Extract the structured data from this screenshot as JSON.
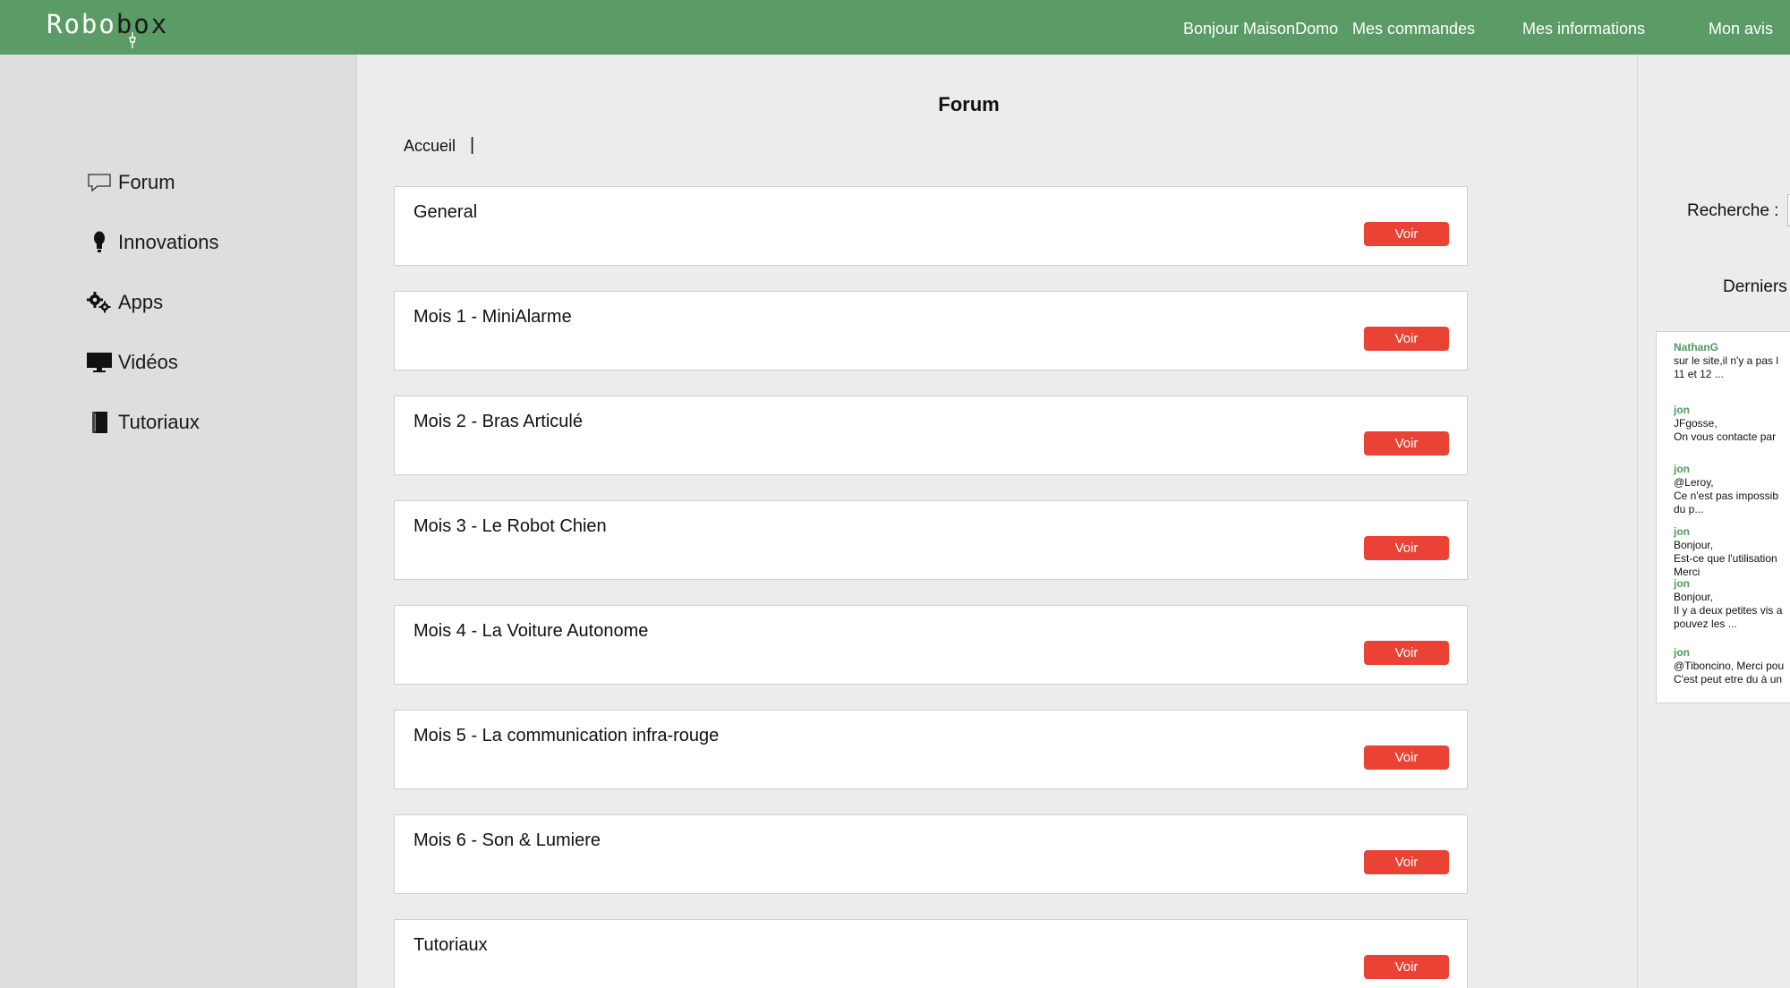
{
  "header": {
    "logo_part1": "Robo",
    "logo_part2": "box",
    "nav": [
      {
        "label": "Bonjour MaisonDomo"
      },
      {
        "label": "Mes commandes"
      },
      {
        "label": "Mes informations"
      },
      {
        "label": "Mon avis"
      }
    ],
    "colors": {
      "bar": "#5b9b65",
      "text": "#ffffff"
    }
  },
  "sidebar": {
    "items": [
      {
        "label": "Forum",
        "icon": "speech-bubble-icon"
      },
      {
        "label": "Innovations",
        "icon": "lightbulb-icon"
      },
      {
        "label": "Apps",
        "icon": "gears-icon"
      },
      {
        "label": "Vidéos",
        "icon": "monitor-icon"
      },
      {
        "label": "Tutoriaux",
        "icon": "book-icon"
      }
    ]
  },
  "main": {
    "title": "Forum",
    "breadcrumb": {
      "home": "Accueil",
      "separator": "|"
    },
    "button_color": "#ea4335",
    "categories": [
      {
        "title": "General",
        "button": "Voir"
      },
      {
        "title": "Mois 1 - MiniAlarme",
        "button": "Voir"
      },
      {
        "title": "Mois 2 - Bras Articulé",
        "button": "Voir"
      },
      {
        "title": "Mois 3 - Le Robot Chien",
        "button": "Voir"
      },
      {
        "title": "Mois 4 - La Voiture Autonome",
        "button": "Voir"
      },
      {
        "title": "Mois 5 - La communication infra-rouge",
        "button": "Voir"
      },
      {
        "title": "Mois 6 - Son & Lumiere",
        "button": "Voir"
      },
      {
        "title": "Tutoriaux",
        "button": "Voir"
      }
    ]
  },
  "right": {
    "search_label": "Recherche :",
    "latest_label": "Derniers",
    "recent": [
      {
        "user": "NathanG",
        "lines": [
          "sur le site,il n'y a pas l",
          "11 et 12 ..."
        ]
      },
      {
        "user": "jon",
        "lines": [
          "JFgosse,",
          "On vous contacte par"
        ]
      },
      {
        "user": "jon",
        "lines": [
          "@Leroy,",
          "Ce n'est pas impossib",
          "du p..."
        ]
      },
      {
        "user": "jon",
        "lines": [
          "Bonjour,",
          "Est-ce que l'utilisation",
          "",
          "Merci"
        ]
      },
      {
        "user": "jon",
        "lines": [
          "Bonjour,",
          "Il y a deux petites vis a",
          "pouvez les ..."
        ]
      },
      {
        "user": "jon",
        "lines": [
          "@Tiboncino, Merci pou",
          "C'est peut etre du à un"
        ]
      }
    ]
  }
}
